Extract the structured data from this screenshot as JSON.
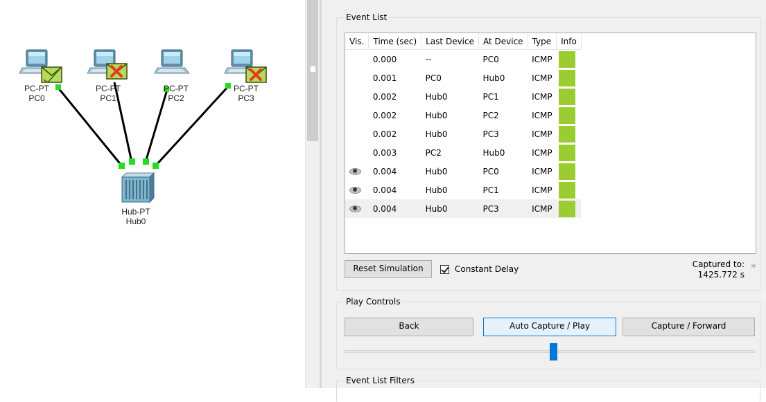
{
  "topology": {
    "devices": [
      {
        "id": "pc0",
        "model": "PC-PT",
        "name": "PC0",
        "envelope": "check"
      },
      {
        "id": "pc1",
        "model": "PC-PT",
        "name": "PC1",
        "envelope": "cross"
      },
      {
        "id": "pc2",
        "model": "PC-PT",
        "name": "PC2",
        "envelope": "none"
      },
      {
        "id": "pc3",
        "model": "PC-PT",
        "name": "PC3",
        "envelope": "cross"
      },
      {
        "id": "hub0",
        "model": "Hub-PT",
        "name": "Hub0",
        "envelope": "none"
      }
    ],
    "link_color": "#000000",
    "port_color": "#22dd22"
  },
  "event_list": {
    "title": "Event List",
    "columns": [
      "Vis.",
      "Time (sec)",
      "Last Device",
      "At Device",
      "Type",
      "Info"
    ],
    "rows": [
      {
        "vis": "",
        "time": "0.000",
        "last": "--",
        "at": "PC0",
        "type": "ICMP"
      },
      {
        "vis": "",
        "time": "0.001",
        "last": "PC0",
        "at": "Hub0",
        "type": "ICMP"
      },
      {
        "vis": "",
        "time": "0.002",
        "last": "Hub0",
        "at": "PC1",
        "type": "ICMP"
      },
      {
        "vis": "",
        "time": "0.002",
        "last": "Hub0",
        "at": "PC2",
        "type": "ICMP"
      },
      {
        "vis": "",
        "time": "0.002",
        "last": "Hub0",
        "at": "PC3",
        "type": "ICMP"
      },
      {
        "vis": "",
        "time": "0.003",
        "last": "PC2",
        "at": "Hub0",
        "type": "ICMP"
      },
      {
        "vis": "eye-icon",
        "time": "0.004",
        "last": "Hub0",
        "at": "PC0",
        "type": "ICMP"
      },
      {
        "vis": "eye-icon",
        "time": "0.004",
        "last": "Hub0",
        "at": "PC1",
        "type": "ICMP"
      },
      {
        "vis": "eye-icon",
        "time": "0.004",
        "last": "Hub0",
        "at": "PC3",
        "type": "ICMP"
      }
    ],
    "selected_row": 8,
    "info_color": "#9acd32",
    "reset_button": "Reset Simulation",
    "constant_delay_label": "Constant Delay",
    "constant_delay_checked": true,
    "captured_label": "Captured to:",
    "captured_value": "1425.772 s",
    "asterisk": "*"
  },
  "play_controls": {
    "title": "Play Controls",
    "back": "Back",
    "auto": "Auto Capture / Play",
    "forward": "Capture / Forward",
    "speed_fraction": 0.51,
    "accent": "#0078d7"
  },
  "filters": {
    "title": "Event List Filters"
  }
}
